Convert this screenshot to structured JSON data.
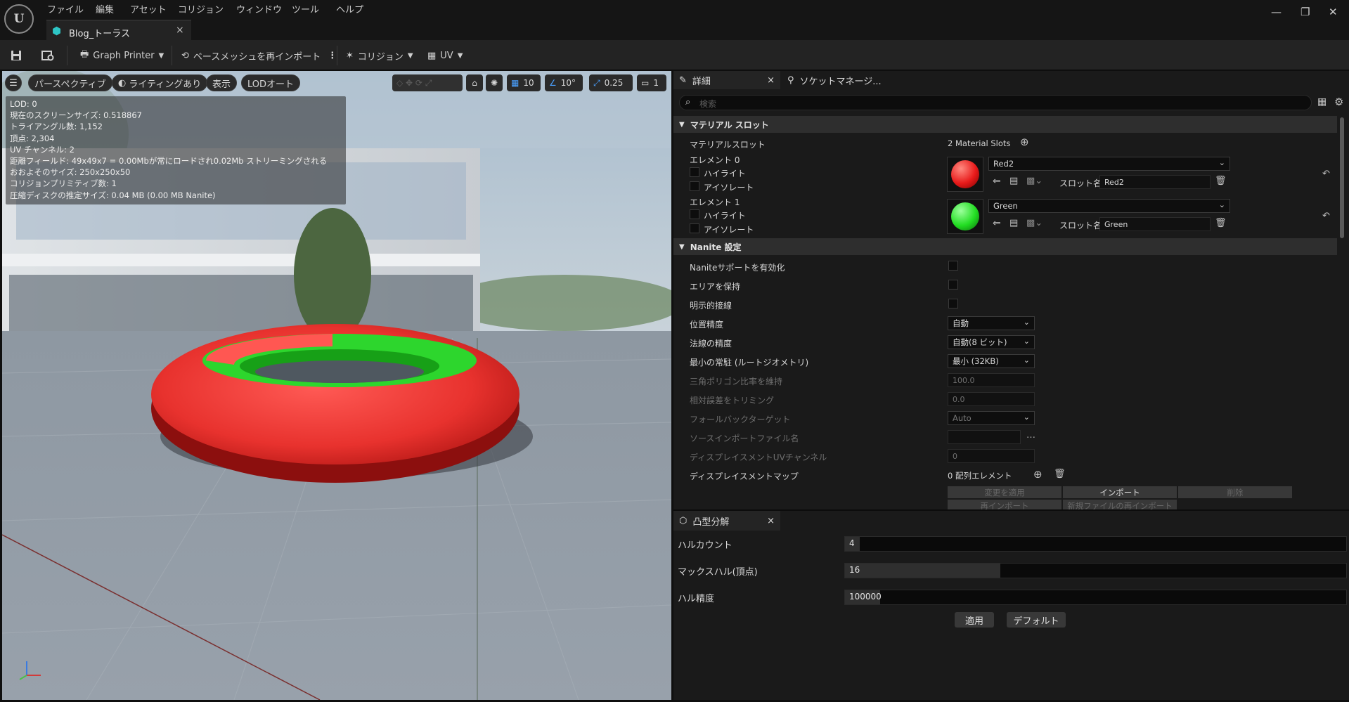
{
  "app": {
    "logo": "U"
  },
  "menu": [
    "ファイル",
    "編集",
    "アセット",
    "コリジョン",
    "ウィンドウ",
    "ツール",
    "ヘルプ"
  ],
  "document_tab": {
    "label": "Blog_トーラス",
    "close": "×"
  },
  "window_controls": {
    "minimize": "—",
    "restore": "❐",
    "close": "✕"
  },
  "toolbar": {
    "graph_printer": "Graph Printer",
    "reimport_base_mesh": "ベースメッシュを再インポート",
    "collision": "コリジョン",
    "uv": "UV"
  },
  "viewport": {
    "perspective": "パースペクティブ",
    "lighting": "ライティングあり",
    "show": "表示",
    "lod": "LODオート",
    "grid_snap": "10",
    "rotation_snap": "10°",
    "scale_snap": "0.25",
    "camera_speed": "1",
    "stats": [
      "LOD: 0",
      "現在のスクリーンサイズ: 0.518867",
      "トライアングル数: 1,152",
      "頂点: 2,304",
      "UV チャンネル: 2",
      "距離フィールド: 49x49x7 = 0.00Mbが常にロードされ0.02Mb ストリーミングされる",
      "おおよそのサイズ: 250x250x50",
      "コリジョンプリミティブ数: 1",
      "圧縮ディスクの推定サイズ: 0.04 MB (0.00 MB Nanite)"
    ]
  },
  "details": {
    "tab_details": "詳細",
    "tab_socket": "ソケットマネージ...",
    "search_placeholder": "検索",
    "material_section": "マテリアル スロット",
    "material_slots_label": "マテリアルスロット",
    "material_slots_value": "2 Material Slots",
    "elements": [
      {
        "label": "エレメント 0",
        "highlight": "ハイライト",
        "isolate": "アイソレート",
        "material": "Red2",
        "slot_name_label": "スロット名",
        "slot_name": "Red2",
        "color": "#e81a1a"
      },
      {
        "label": "エレメント 1",
        "highlight": "ハイライト",
        "isolate": "アイソレート",
        "material": "Green",
        "slot_name_label": "スロット名",
        "slot_name": "Green",
        "color": "#22dd22"
      }
    ],
    "nanite_section": "Nanite 設定",
    "nanite_rows": [
      {
        "label": "Naniteサポートを有効化",
        "type": "checkbox"
      },
      {
        "label": "エリアを保持",
        "type": "checkbox"
      },
      {
        "label": "明示的接線",
        "type": "checkbox"
      },
      {
        "label": "位置精度",
        "type": "dropdown",
        "value": "自動"
      },
      {
        "label": "法線の精度",
        "type": "dropdown",
        "value": "自動(8 ビット)"
      },
      {
        "label": "最小の常駐 (ルートジオメトリ)",
        "type": "dropdown",
        "value": "最小 (32KB)"
      },
      {
        "label": "三角ポリゴン比率を維持",
        "type": "text",
        "value": "100.0",
        "dim": true
      },
      {
        "label": "相対誤差をトリミング",
        "type": "text",
        "value": "0.0",
        "dim": true
      },
      {
        "label": "フォールバックターゲット",
        "type": "dropdown",
        "value": "Auto",
        "dim": true
      },
      {
        "label": "ソースインポートファイル名",
        "type": "file",
        "value": "",
        "dim": true
      },
      {
        "label": "ディスプレイスメントUVチャンネル",
        "type": "text",
        "value": "0",
        "dim": true
      },
      {
        "label": "ディスプレイスメントマップ",
        "type": "array",
        "value": "0 配列エレメント"
      }
    ],
    "buttons_row1": [
      "変更を適用",
      "インポート",
      "削除"
    ],
    "buttons_row2": [
      "再インポート",
      "新規ファイルの再インポート"
    ]
  },
  "convex": {
    "tab": "凸型分解",
    "hull_count_label": "ハルカウント",
    "hull_count": "4",
    "hull_count_fraction": 0.03,
    "max_hull_label": "マックスハル(頂点)",
    "max_hull": "16",
    "max_hull_fraction": 0.31,
    "precision_label": "ハル精度",
    "precision": "100000",
    "precision_fraction": 0.07,
    "apply": "適用",
    "default": "デフォルト"
  }
}
